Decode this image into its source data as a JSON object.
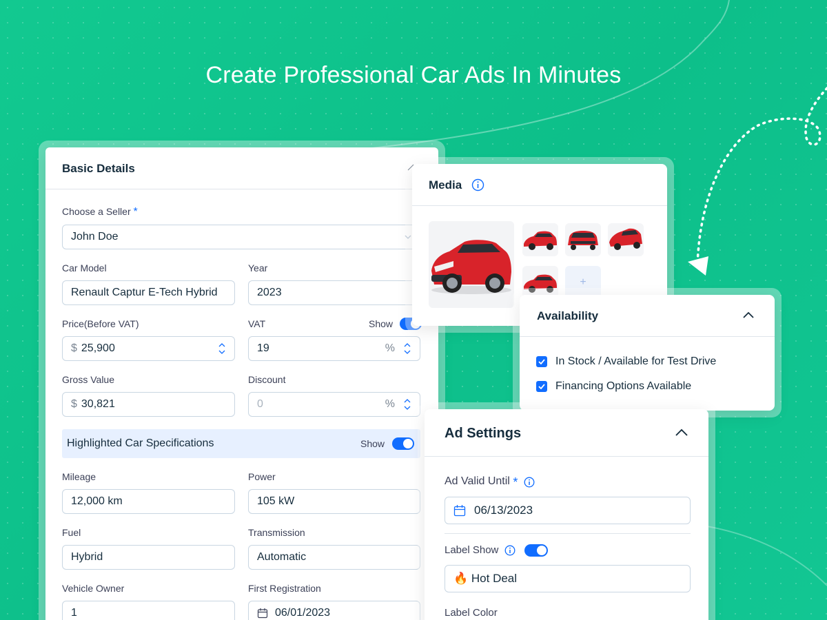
{
  "headline": "Create Professional Car Ads In Minutes",
  "colors": {
    "background": "#12c990",
    "accent": "#116dff",
    "text": "#162d3d",
    "highlight": "#e7f0ff"
  },
  "basic_details": {
    "title": "Basic Details",
    "seller": {
      "label": "Choose a Seller",
      "required_mark": "*",
      "value": "John Doe"
    },
    "car_model": {
      "label": "Car Model",
      "value": "Renault Captur E-Tech Hybrid"
    },
    "year": {
      "label": "Year",
      "value": "2023"
    },
    "price": {
      "label": "Price(Before VAT)",
      "currency": "$",
      "value": "25,900"
    },
    "vat": {
      "label": "VAT",
      "show_label": "Show",
      "value": "19",
      "unit": "%"
    },
    "gross": {
      "label": "Gross Value",
      "currency": "$",
      "value": "30,821"
    },
    "discount": {
      "label": "Discount",
      "placeholder": "0",
      "unit": "%"
    },
    "highlighted": {
      "label": "Highlighted Car Specifications",
      "show_label": "Show"
    },
    "mileage": {
      "label": "Mileage",
      "value": "12,000 km"
    },
    "power": {
      "label": "Power",
      "value": "105 kW"
    },
    "fuel": {
      "label": "Fuel",
      "value": "Hybrid"
    },
    "transmission": {
      "label": "Transmission",
      "value": "Automatic"
    },
    "owner": {
      "label": "Vehicle Owner",
      "value": "1"
    },
    "registration": {
      "label": "First Registration",
      "value": "06/01/2023"
    }
  },
  "media": {
    "title": "Media",
    "add_symbol": "+"
  },
  "availability": {
    "title": "Availability",
    "options": [
      {
        "label": "In Stock / Available for Test Drive",
        "checked": true
      },
      {
        "label": "Financing Options Available",
        "checked": true
      }
    ]
  },
  "ad_settings": {
    "title": "Ad Settings",
    "valid_until": {
      "label": "Ad Valid Until",
      "required_mark": "*",
      "value": "06/13/2023"
    },
    "label_show": {
      "label": "Label Show",
      "value": "🔥 Hot Deal"
    },
    "label_color": {
      "label": "Label Color"
    }
  }
}
